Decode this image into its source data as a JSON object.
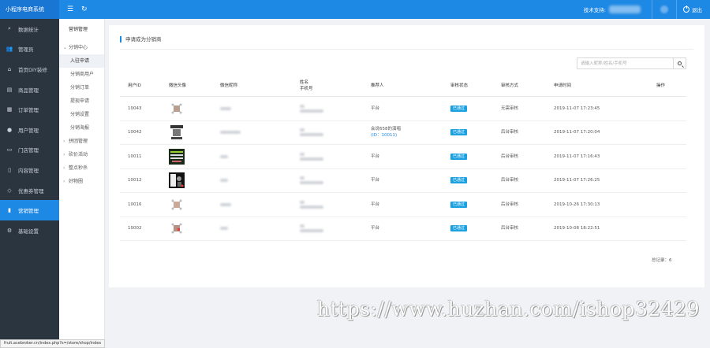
{
  "app": {
    "title": "小程序电商系统"
  },
  "topbar": {
    "tech_support_label": "技术支持:",
    "logout_label": "退出"
  },
  "sidebar": {
    "items": [
      {
        "label": "数据统计",
        "icon": "search-icon",
        "active": false
      },
      {
        "label": "管理员",
        "icon": "user-group-icon",
        "active": false
      },
      {
        "label": "首页DIY装修",
        "icon": "home-icon",
        "active": false
      },
      {
        "label": "商品管理",
        "icon": "box-icon",
        "active": false
      },
      {
        "label": "订单管理",
        "icon": "order-icon",
        "active": false
      },
      {
        "label": "用户管理",
        "icon": "user-icon",
        "active": false
      },
      {
        "label": "门店管理",
        "icon": "store-icon",
        "active": false
      },
      {
        "label": "内容管理",
        "icon": "document-icon",
        "active": false
      },
      {
        "label": "优惠券管理",
        "icon": "tag-icon",
        "active": false
      },
      {
        "label": "营销管理",
        "icon": "chart-icon",
        "active": true
      },
      {
        "label": "基础设置",
        "icon": "gear-icon",
        "active": false
      }
    ]
  },
  "submenu": {
    "title": "营销管理",
    "groups": [
      {
        "label": "分销中心",
        "expanded": true,
        "children": [
          {
            "label": "入驻申请",
            "active": true
          },
          {
            "label": "分销商用户",
            "active": false
          },
          {
            "label": "分销订单",
            "active": false
          },
          {
            "label": "提现申请",
            "active": false
          },
          {
            "label": "分销设置",
            "active": false
          },
          {
            "label": "分销海报",
            "active": false
          }
        ]
      },
      {
        "label": "拼团管理",
        "expanded": false
      },
      {
        "label": "砍价活动",
        "expanded": false
      },
      {
        "label": "整点秒杀",
        "expanded": false
      },
      {
        "label": "好物圈",
        "expanded": false
      }
    ]
  },
  "panel": {
    "title": "申请成为分销商",
    "search_placeholder": "请输入昵称/姓名/手机号",
    "columns": {
      "user_id": "用户ID",
      "avatar": "微信头像",
      "nickname": "微信昵称",
      "name": "姓名",
      "phone": "手机号",
      "referrer": "推荐人",
      "status": "审核状态",
      "method": "审核方式",
      "time": "申请时间",
      "action": "操作"
    },
    "rows": [
      {
        "user_id": "10043",
        "referrer": "平台",
        "status": "已通过",
        "method": "无需审核",
        "time": "2019-11-07 17:23:45"
      },
      {
        "user_id": "10042",
        "referrer": "会说658的演唱",
        "referrer_sub": "(ID：10011)",
        "status": "已通过",
        "method": "后台审核",
        "time": "2019-11-07 17:20:04"
      },
      {
        "user_id": "10011",
        "referrer": "平台",
        "status": "已通过",
        "method": "后台审核",
        "time": "2019-11-07 17:16:43"
      },
      {
        "user_id": "10012",
        "referrer": "平台",
        "status": "已通过",
        "method": "后台审核",
        "time": "2019-11-07 17:26:25"
      },
      {
        "user_id": "10016",
        "referrer": "平台",
        "status": "已通过",
        "method": "后台审核",
        "time": "2019-10-26 17:30:13"
      },
      {
        "user_id": "10002",
        "referrer": "平台",
        "status": "已通过",
        "method": "后台审核",
        "time": "2019-10-08 18:22:51"
      }
    ],
    "total_label": "总记录：6"
  },
  "watermark": "https://www.huzhan.com/ishop32429",
  "statusbar": "fruit.acebroker.cn/index.php?s=/store/shop/index",
  "colors": {
    "primary": "#1e88e5",
    "sidebar_bg": "#2b3540",
    "badge": "#1ba1e2"
  }
}
